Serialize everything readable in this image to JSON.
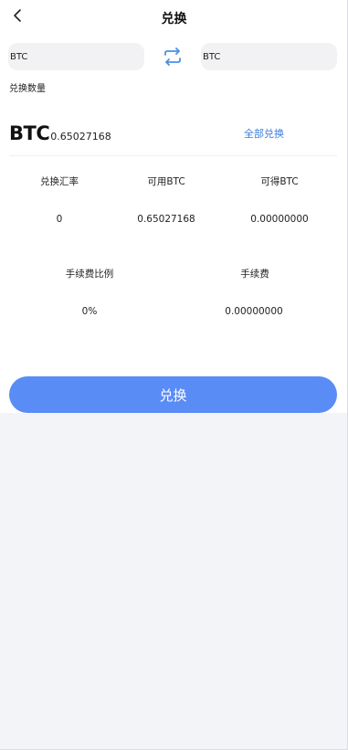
{
  "header": {
    "title": "兑换",
    "back_icon": "chevron-left-icon"
  },
  "exchange": {
    "from_coin": "BTC",
    "to_coin": "BTC",
    "swap_icon": "swap-arrows-icon",
    "amount_label": "兑换数量",
    "amount_coin": "BTC",
    "amount_value": "0.65027168",
    "exchange_all_label": "全部兑换"
  },
  "stats": {
    "rate_label": "兑换汇率",
    "rate_value": "0",
    "available_label": "可用BTC",
    "available_value": "0.65027168",
    "receivable_label": "可得BTC",
    "receivable_value": "0.00000000",
    "fee_ratio_label": "手续费比例",
    "fee_ratio_value": "0%",
    "fee_label": "手续费",
    "fee_value": "0.00000000"
  },
  "actions": {
    "submit_label": "兑换"
  },
  "colors": {
    "accent": "#3b7de0",
    "button": "#5a8cf6",
    "swap_icon": "#4a90e2"
  }
}
